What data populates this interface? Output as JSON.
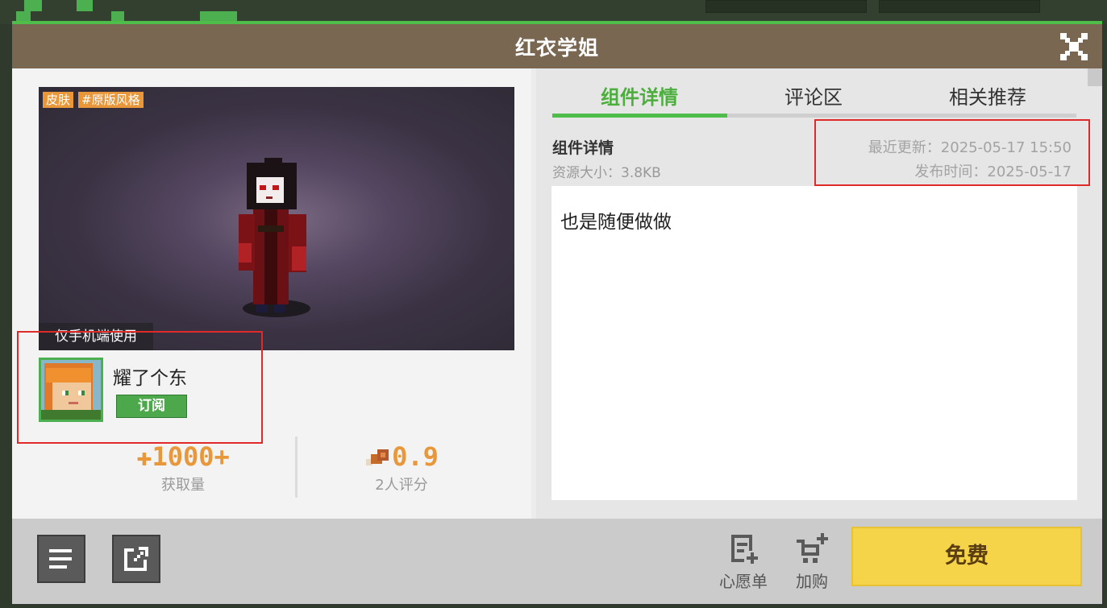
{
  "header": {
    "title": "红衣学姐"
  },
  "preview": {
    "tags": [
      "皮肤",
      "#原版风格"
    ],
    "platform_note": "仅手机端使用"
  },
  "author": {
    "name": "耀了个东",
    "subscribe_label": "订阅"
  },
  "stats": {
    "downloads": {
      "value": "1000+",
      "label": "获取量"
    },
    "rating": {
      "value": "0.9",
      "label": "2人评分"
    }
  },
  "tabs": [
    {
      "label": "组件详情",
      "active": true
    },
    {
      "label": "评论区",
      "active": false
    },
    {
      "label": "相关推荐",
      "active": false
    }
  ],
  "details": {
    "heading": "组件详情",
    "size": "资源大小：3.8KB",
    "updated": "最近更新：2025-05-17 15:50",
    "published": "发布时间：2025-05-17",
    "description": "也是随便做做"
  },
  "bottom": {
    "wishlist_label": "心愿单",
    "cart_label": "加购",
    "buy_label": "免费"
  },
  "colors": {
    "accent_green": "#4fbd49",
    "title_bar": "#7a6752",
    "stat_orange": "#e8973a",
    "buy_yellow": "#f5d44a",
    "highlight_red": "#e02a2a"
  }
}
